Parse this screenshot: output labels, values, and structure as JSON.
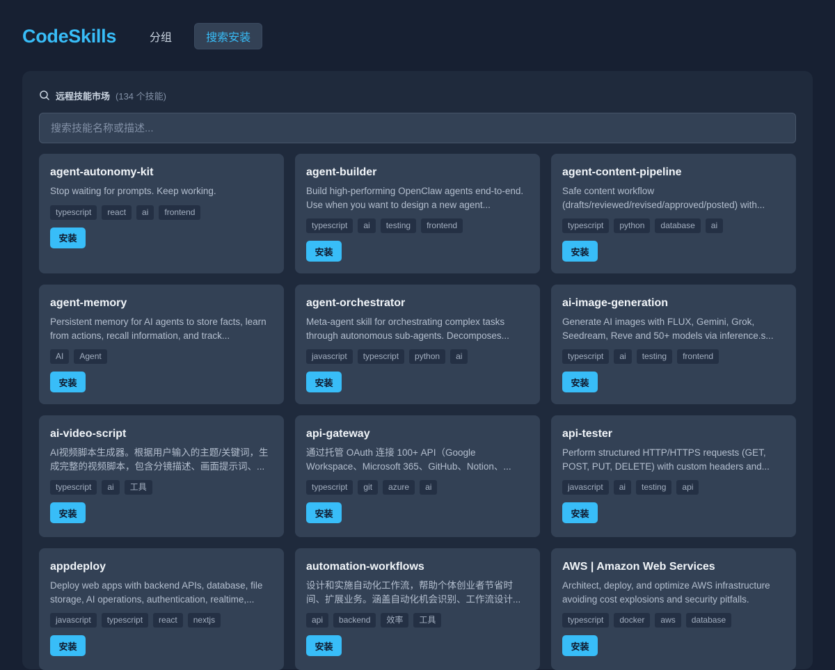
{
  "header": {
    "logo": "CodeSkills",
    "nav": [
      {
        "label": "分组"
      },
      {
        "label": "搜索安装"
      }
    ]
  },
  "market": {
    "title": "远程技能市场",
    "count": "(134 个技能)",
    "search_placeholder": "搜索技能名称或描述..."
  },
  "install_label": "安装",
  "skills": [
    {
      "name": "agent-autonomy-kit",
      "desc": "Stop waiting for prompts. Keep working.",
      "tags": [
        "typescript",
        "react",
        "ai",
        "frontend"
      ]
    },
    {
      "name": "agent-builder",
      "desc": "Build high-performing OpenClaw agents end-to-end. Use when you want to design a new agent...",
      "tags": [
        "typescript",
        "ai",
        "testing",
        "frontend"
      ]
    },
    {
      "name": "agent-content-pipeline",
      "desc": "Safe content workflow (drafts/reviewed/revised/approved/posted) with...",
      "tags": [
        "typescript",
        "python",
        "database",
        "ai"
      ]
    },
    {
      "name": "agent-memory",
      "desc": "Persistent memory for AI agents to store facts, learn from actions, recall information, and track...",
      "tags": [
        "AI",
        "Agent"
      ]
    },
    {
      "name": "agent-orchestrator",
      "desc": "Meta-agent skill for orchestrating complex tasks through autonomous sub-agents. Decomposes...",
      "tags": [
        "javascript",
        "typescript",
        "python",
        "ai"
      ]
    },
    {
      "name": "ai-image-generation",
      "desc": "Generate AI images with FLUX, Gemini, Grok, Seedream, Reve and 50+ models via inference.s...",
      "tags": [
        "typescript",
        "ai",
        "testing",
        "frontend"
      ]
    },
    {
      "name": "ai-video-script",
      "desc": "AI视频脚本生成器。根据用户输入的主题/关键词，生成完整的视频脚本，包含分镜描述、画面提示词、...",
      "tags": [
        "typescript",
        "ai",
        "工具"
      ]
    },
    {
      "name": "api-gateway",
      "desc": "通过托管 OAuth 连接 100+ API（Google Workspace、Microsoft 365、GitHub、Notion、...",
      "tags": [
        "typescript",
        "git",
        "azure",
        "ai"
      ]
    },
    {
      "name": "api-tester",
      "desc": "Perform structured HTTP/HTTPS requests (GET, POST, PUT, DELETE) with custom headers and...",
      "tags": [
        "javascript",
        "ai",
        "testing",
        "api"
      ]
    },
    {
      "name": "appdeploy",
      "desc": "Deploy web apps with backend APIs, database, file storage, AI operations, authentication, realtime,...",
      "tags": [
        "javascript",
        "typescript",
        "react",
        "nextjs"
      ]
    },
    {
      "name": "automation-workflows",
      "desc": "设计和实施自动化工作流，帮助个体创业者节省时间、扩展业务。涵盖自动化机会识别、工作流设计...",
      "tags": [
        "api",
        "backend",
        "效率",
        "工具"
      ]
    },
    {
      "name": "AWS | Amazon Web Services",
      "desc": "Architect, deploy, and optimize AWS infrastructure avoiding cost explosions and security pitfalls.",
      "tags": [
        "typescript",
        "docker",
        "aws",
        "database"
      ]
    }
  ]
}
